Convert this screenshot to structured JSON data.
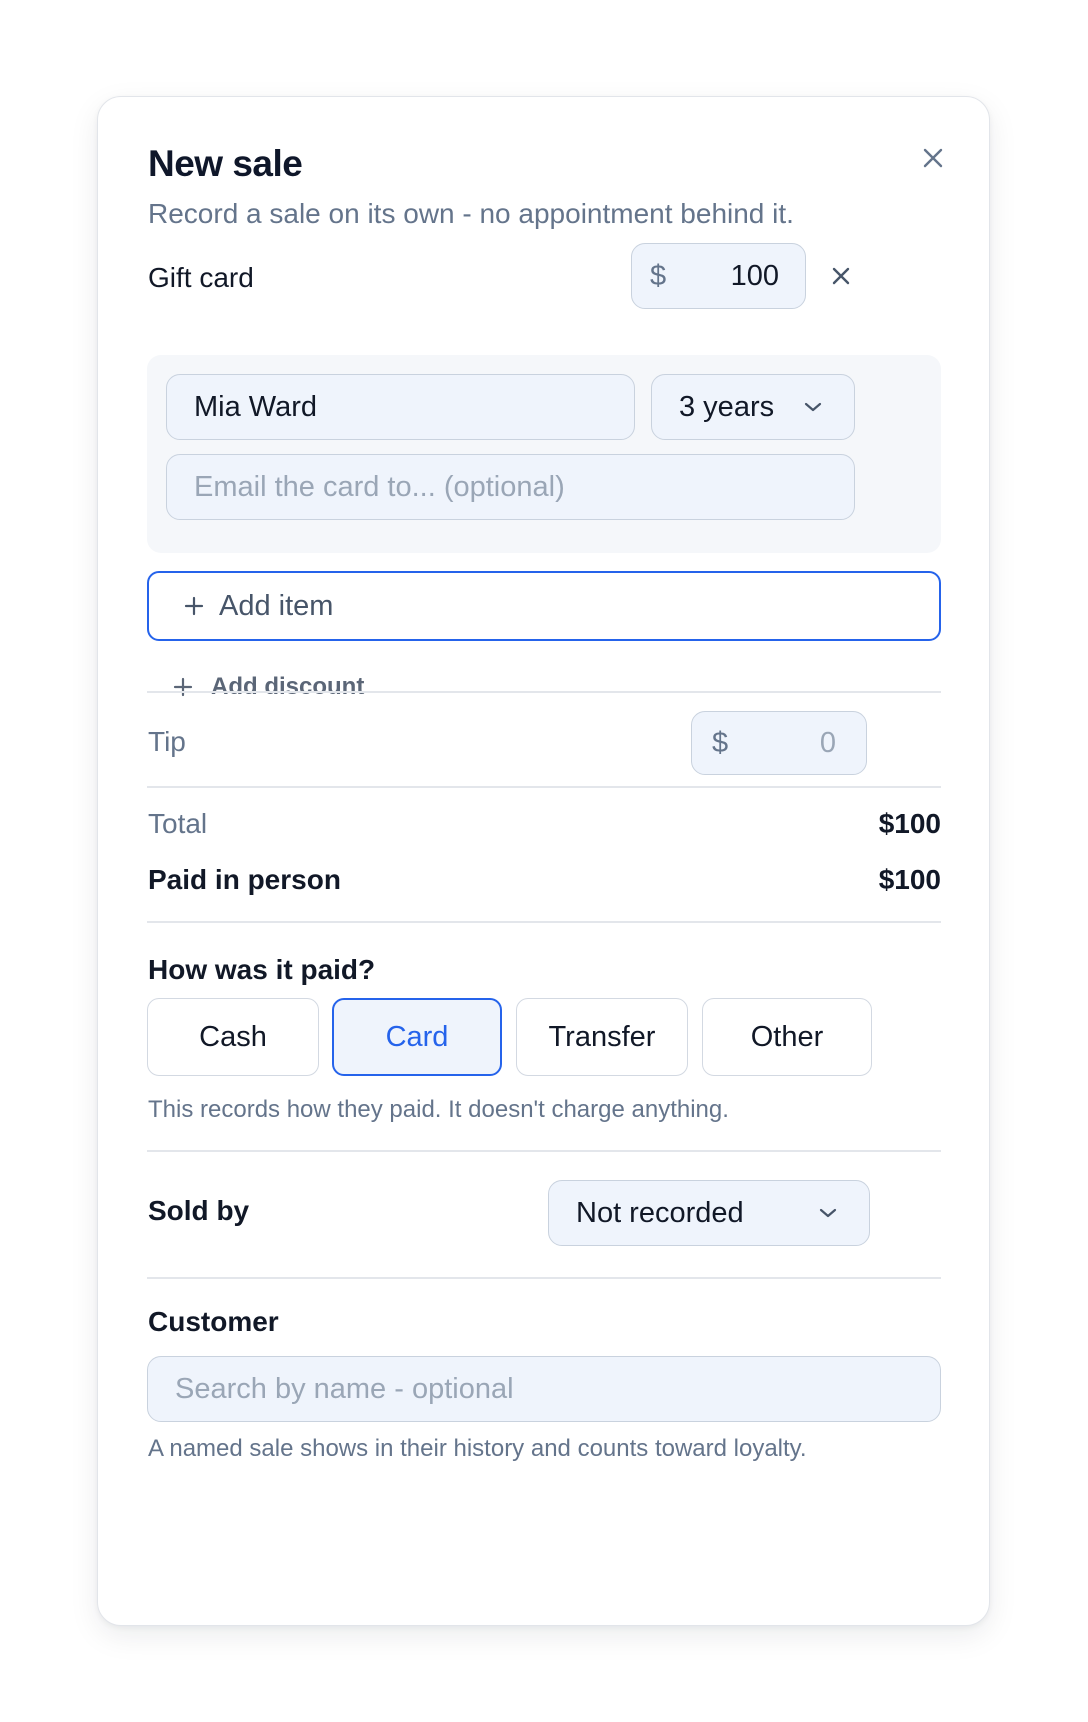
{
  "dialog": {
    "title": "New sale",
    "subtitle": "Record a sale on its own - no appointment behind it."
  },
  "gift_card": {
    "label": "Gift card",
    "currency": "$",
    "amount": "100",
    "recipient_name": "Mia Ward",
    "validity": "3 years",
    "email_placeholder": "Email the card to... (optional)"
  },
  "actions": {
    "add_item": "Add item",
    "add_discount": "Add discount"
  },
  "tip": {
    "label": "Tip",
    "currency": "$",
    "placeholder": "0"
  },
  "totals": {
    "total_label": "Total",
    "total_value": "$100",
    "paid_label": "Paid in person",
    "paid_value": "$100"
  },
  "payment": {
    "question": "How was it paid?",
    "options": [
      "Cash",
      "Card",
      "Transfer",
      "Other"
    ],
    "selected": "Card",
    "note": "This records how they paid. It doesn't charge anything."
  },
  "sold_by": {
    "label": "Sold by",
    "value": "Not recorded"
  },
  "customer": {
    "label": "Customer",
    "placeholder": "Search by name - optional",
    "note": "A named sale shows in their history and counts toward loyalty."
  },
  "colors": {
    "accent": "#2563eb",
    "input_bg": "#eff4fc",
    "muted_text": "#64748b"
  }
}
